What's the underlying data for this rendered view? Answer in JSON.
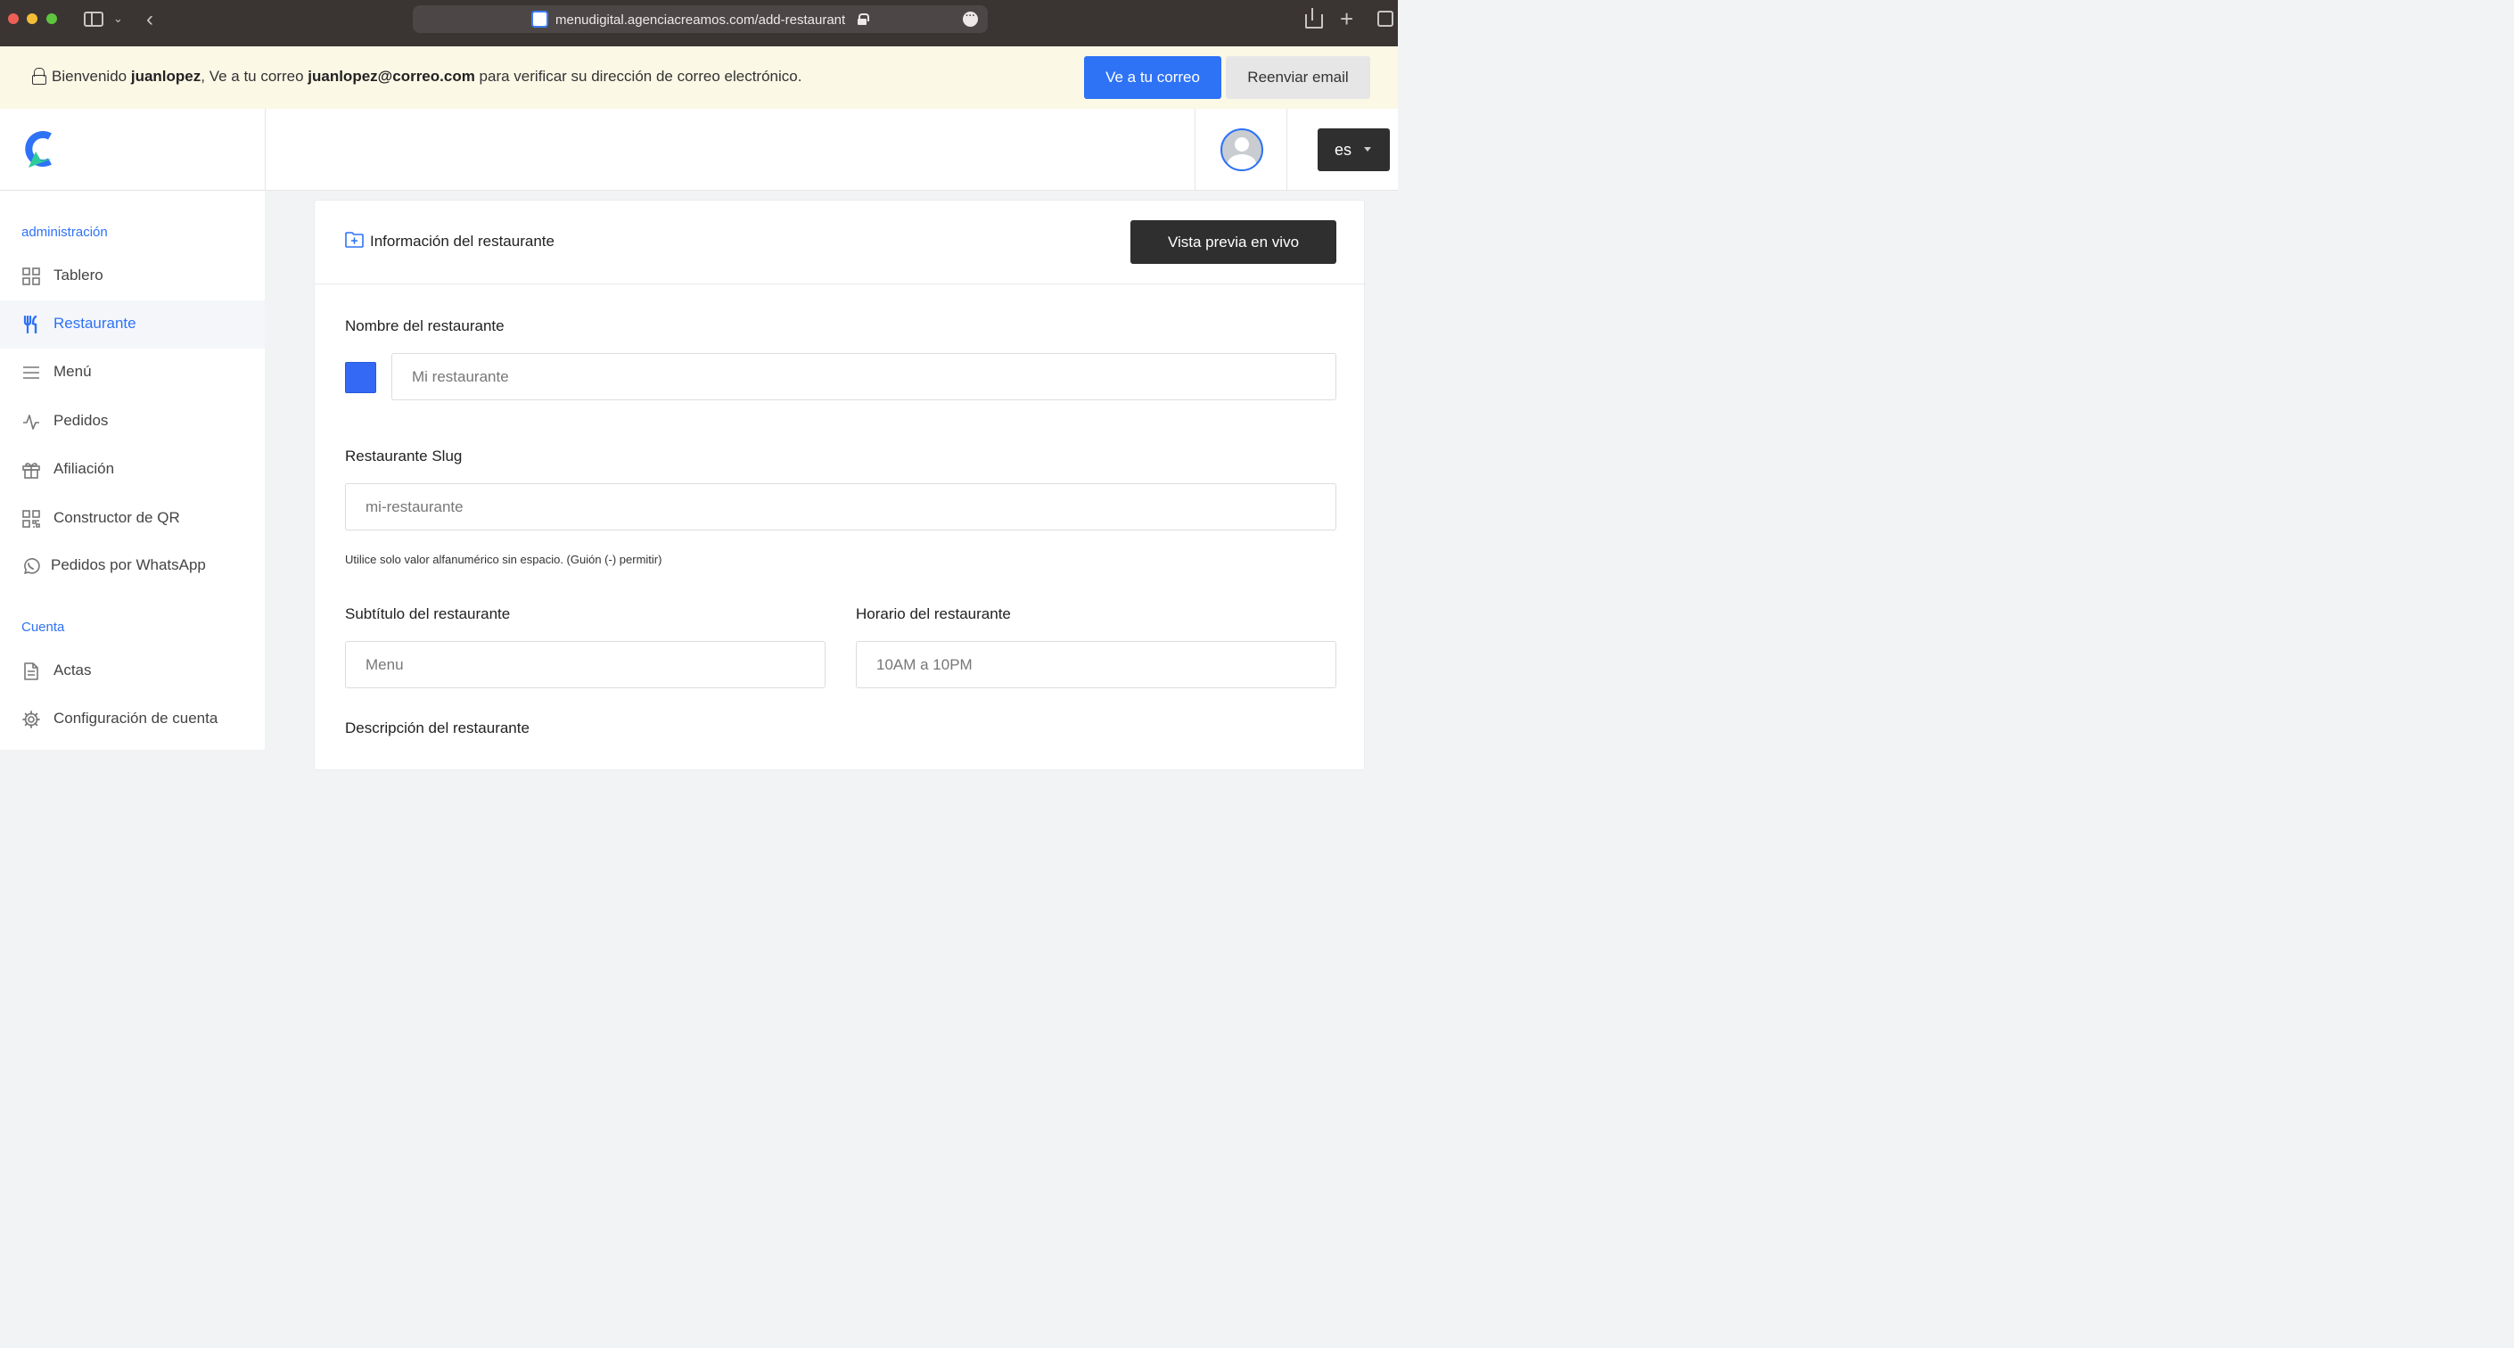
{
  "browser": {
    "url": "menudigital.agenciacreamos.com/add-restaurant"
  },
  "banner": {
    "prefix": "Bienvenido ",
    "username": "juanlopez",
    "middle": ", Ve a tu correo ",
    "email": "juanlopez@correo.com",
    "suffix": " para verificar su dirección de correo electrónico.",
    "primary_button": "Ve a tu correo",
    "secondary_button": "Reenviar email"
  },
  "header": {
    "language": "es"
  },
  "sidebar": {
    "admin_section": "administración",
    "admin_items": [
      {
        "label": "Tablero",
        "icon": "grid-icon"
      },
      {
        "label": "Restaurante",
        "icon": "utensils-icon",
        "active": true
      },
      {
        "label": "Menú",
        "icon": "menu-lines-icon"
      },
      {
        "label": "Pedidos",
        "icon": "activity-icon"
      },
      {
        "label": "Afiliación",
        "icon": "gift-icon"
      },
      {
        "label": "Constructor de QR",
        "icon": "qr-icon"
      },
      {
        "label": "Pedidos por WhatsApp",
        "icon": "whatsapp-icon"
      }
    ],
    "account_section": "Cuenta",
    "account_items": [
      {
        "label": "Actas",
        "icon": "document-icon"
      },
      {
        "label": "Configuración de cuenta",
        "icon": "gear-icon"
      }
    ]
  },
  "card": {
    "title": "Información del restaurante",
    "preview_button": "Vista previa en vivo",
    "fields": {
      "name_label": "Nombre del restaurante",
      "name_placeholder": "Mi restaurante",
      "slug_label": "Restaurante Slug",
      "slug_placeholder": "mi-restaurante",
      "slug_help": "Utilice solo valor alfanumérico sin espacio. (Guión (-) permitir)",
      "subtitle_label": "Subtítulo del restaurante",
      "subtitle_placeholder": "Menu",
      "hours_label": "Horario del restaurante",
      "hours_placeholder": "10AM a 10PM",
      "description_label": "Descripción del restaurante"
    },
    "swatch_color": "#3469f5"
  },
  "colors": {
    "accent": "#2e72f6",
    "dark_button": "#2f2f2f",
    "banner_bg": "#fbf8e6"
  }
}
